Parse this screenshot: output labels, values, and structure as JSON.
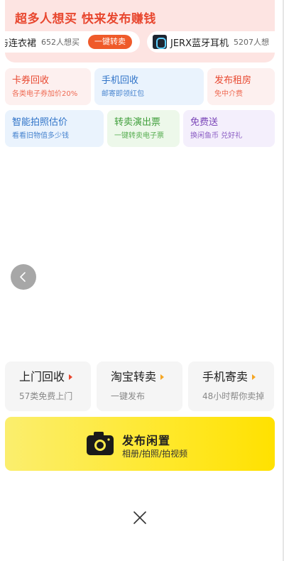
{
  "banner": {
    "title": "超多人想买 快来发布赚钱",
    "ticker": [
      {
        "name": "与连衣裙",
        "count": "652人想买",
        "button": "一键转卖"
      },
      {
        "name": "JERX蓝牙耳机",
        "count": "5207人想",
        "thumb_icon": "earphone-thumbnail"
      }
    ]
  },
  "services_row1": [
    {
      "title": "卡券回收",
      "subtitle": "各类电子券加价20%",
      "color": "red"
    },
    {
      "title": "手机回收",
      "subtitle": "邮寄即领红包",
      "color": "blue"
    },
    {
      "title": "发布租房",
      "subtitle": "免中介费",
      "color": "red"
    }
  ],
  "services_row2": [
    {
      "title": "智能拍照估价",
      "subtitle": "看看旧物值多少钱",
      "color": "blue"
    },
    {
      "title": "转卖演出票",
      "subtitle": "一键转卖电子票",
      "color": "green"
    },
    {
      "title": "免费送",
      "subtitle": "换闲鱼币 兑好礼",
      "color": "purple"
    }
  ],
  "bottom_cards": [
    {
      "title": "上门回收",
      "subtitle": "57类免费上门",
      "arrow_color": "#e8472f"
    },
    {
      "title": "淘宝转卖",
      "subtitle": "一键发布",
      "arrow_color": "#f5a623"
    },
    {
      "title": "手机寄卖",
      "subtitle": "48小时帮你卖掉",
      "arrow_color": "#f5a623"
    }
  ],
  "publish": {
    "title": "发布闲置",
    "subtitle": "相册/拍照/拍视频",
    "icon": "camera-icon"
  },
  "icons": {
    "back": "chevron-left-icon",
    "close": "close-icon"
  }
}
